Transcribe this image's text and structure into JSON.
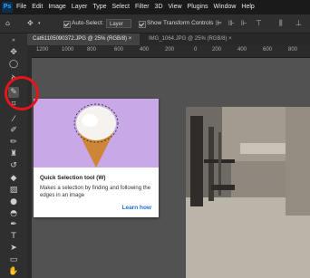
{
  "app": {
    "logo": "Ps"
  },
  "menu": [
    "File",
    "Edit",
    "Image",
    "Layer",
    "Type",
    "Select",
    "Filter",
    "3D",
    "View",
    "Plugins",
    "Window",
    "Help"
  ],
  "options_bar": {
    "auto_select_label": "Auto-Select:",
    "layer_select": "Layer",
    "show_transform_label": "Show Transform Controls"
  },
  "tabs": [
    {
      "label": "Cat61105090372.JPG @ 25% (RGB/8) ×",
      "active": true
    },
    {
      "label": "IMG_1064.JPG @ 25% (RGB/8) ×",
      "active": false
    }
  ],
  "ruler": {
    "ticks": [
      "1200",
      "1000",
      "800",
      "600",
      "400",
      "200",
      "0",
      "200",
      "400",
      "600",
      "800"
    ]
  },
  "tooltip": {
    "title": "Quick Selection tool (W)",
    "description": "Makes a selection by finding and following the edges in an image",
    "link": "Learn how"
  },
  "colors": {
    "highlight": "#e8141b",
    "tooltip_image_bg": "#c8a8e6",
    "link": "#1f6fd6"
  },
  "icons": [
    "move-icon",
    "marquee-icon",
    "lasso-icon",
    "quick-selection-icon",
    "crop-icon",
    "eyedropper-icon",
    "healing-icon",
    "brush-icon",
    "stamp-icon",
    "history-brush-icon",
    "eraser-icon",
    "gradient-icon",
    "blur-icon",
    "dodge-icon",
    "pen-icon",
    "type-icon",
    "path-selection-icon",
    "rectangle-icon",
    "hand-icon",
    "zoom-icon"
  ]
}
